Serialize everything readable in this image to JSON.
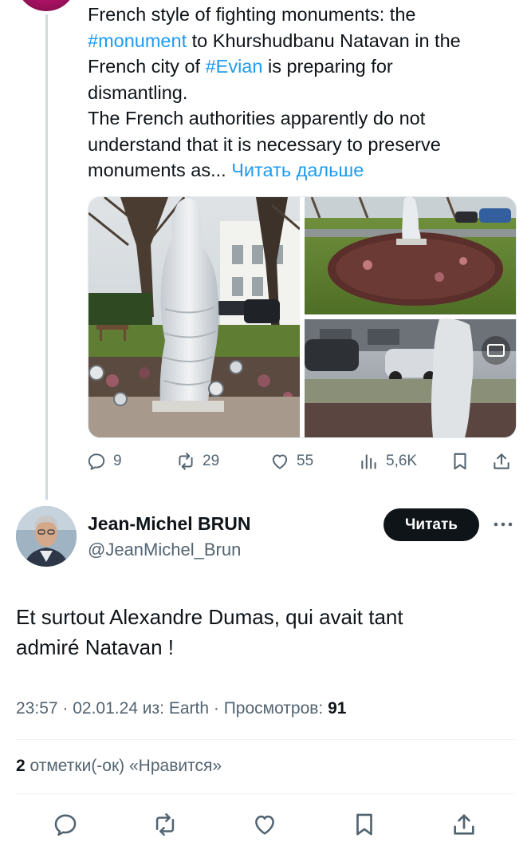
{
  "parent_tweet": {
    "text_lines": {
      "l1": "French style of fighting monuments: the",
      "l2_hashtag": "#monument",
      "l2_rest": " to Khurshudbanu Natavan in the",
      "l3_start": "French city of ",
      "l3_hashtag": "#Evian",
      "l3_rest": " is preparing for",
      "l4": "dismantling.",
      "l5": "The French authorities apparently do not",
      "l6": "understand that it is necessary to preserve",
      "l7_start": "monuments as... ",
      "l7_more": "Читать дальше"
    },
    "actions": {
      "replies": "9",
      "reposts": "29",
      "likes": "55",
      "views": "5,6K"
    },
    "icons": [
      "reply-icon",
      "repost-icon",
      "like-icon",
      "views-icon",
      "bookmark-icon",
      "share-icon"
    ]
  },
  "reply_tweet": {
    "author_name": "Jean-Michel BRUN",
    "author_handle": "@JeanMichel_Brun",
    "follow_label": "Читать",
    "text_line1": "Et surtout Alexandre Dumas, qui avait tant",
    "text_line2": "admiré Natavan !",
    "meta": {
      "time_date": "23:57 · 02.01.24 ",
      "source_prefix": "из: ",
      "source": "Earth",
      "views_prefix": " · Просмотров: ",
      "views_count": "91"
    },
    "likes": {
      "count": "2",
      "label": " отметки(-ок) «Нравится»"
    }
  },
  "colors": {
    "link": "#1d9bf0",
    "text_primary": "#0f1419",
    "text_secondary": "#536471",
    "follow_button_bg": "#0f1419"
  }
}
